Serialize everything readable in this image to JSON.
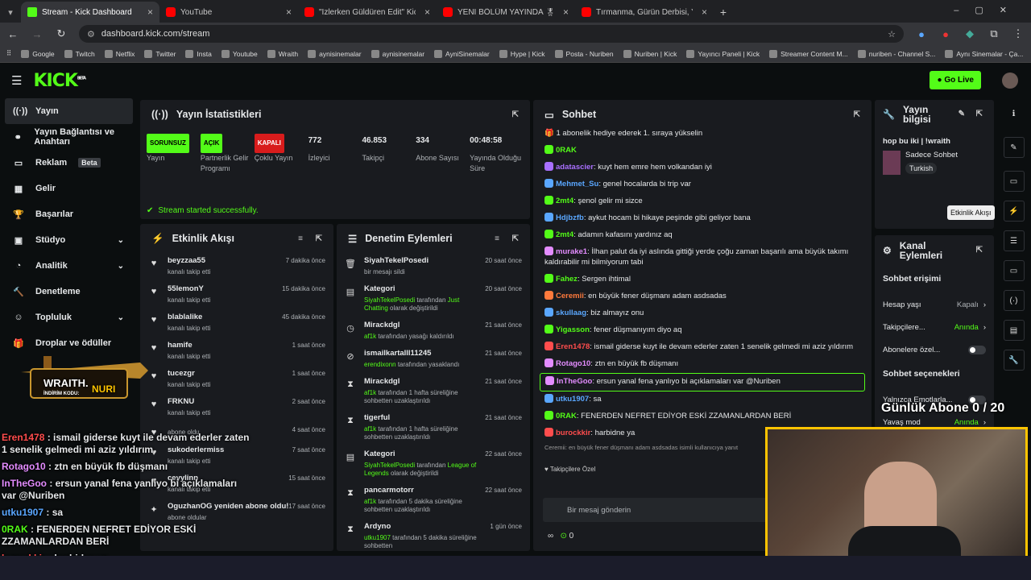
{
  "browser": {
    "tabs": [
      {
        "title": "Stream - Kick Dashboard",
        "icon": "kick-icon",
        "active": true
      },
      {
        "title": "YouTube",
        "icon": "youtube-icon"
      },
      {
        "title": "\"İzlerken Güldüren Edit\" Kick &",
        "icon": "youtube-icon"
      },
      {
        "title": "YENİ BÖLÜM YAYINDA 🎖 @O",
        "icon": "youtube-icon"
      },
      {
        "title": "Tırmanma, Gürün Derbisi, Yükse",
        "icon": "youtube-icon"
      }
    ],
    "url": "dashboard.kick.com/stream",
    "bookmarks": [
      "Google",
      "Twitch",
      "Netflix",
      "Twitter",
      "Insta",
      "Youtube",
      "Wraith",
      "aynisinemalar",
      "aynisinemalar",
      "AyniSinemalar",
      "Hype | Kick",
      "Posta - Nuriben",
      "Nuriben | Kick",
      "Yayıncı Paneli | Kick",
      "Streamer Content M...",
      "nuriben - Channel S...",
      "Aynı Sinemalar - Ça..."
    ]
  },
  "header": {
    "logo": "KICK",
    "beta": "BETA",
    "go_live": "Go Live"
  },
  "sidebar": {
    "items": [
      {
        "label": "Yayın",
        "icon": "broadcast-icon"
      },
      {
        "label": "Yayın Bağlantısı ve Anahtarı",
        "icon": "link-icon"
      },
      {
        "label": "Reklam",
        "badge": "Beta",
        "icon": "ad-icon"
      },
      {
        "label": "Gelir",
        "icon": "revenue-icon"
      },
      {
        "label": "Başarılar",
        "icon": "trophy-icon"
      },
      {
        "label": "Stüdyo",
        "icon": "studio-icon"
      },
      {
        "label": "Analitik",
        "icon": "analytics-icon"
      },
      {
        "label": "Denetleme",
        "icon": "hammer-icon"
      },
      {
        "label": "Topluluk",
        "icon": "community-icon"
      },
      {
        "label": "Droplar ve ödüller",
        "icon": "gift-icon"
      }
    ]
  },
  "stats": {
    "title": "Yayın İstatistikleri",
    "items": [
      {
        "value": "SORUNSUZ",
        "label": "Yayın",
        "pill": "g"
      },
      {
        "value": "AÇIK",
        "label": "Partnerlik Gelir Programı",
        "pill": "g"
      },
      {
        "value": "KAPALI",
        "label": "Çoklu Yayın",
        "pill": "r"
      },
      {
        "value": "772",
        "label": "İzleyici"
      },
      {
        "value": "46.853",
        "label": "Takipçi"
      },
      {
        "value": "334",
        "label": "Abone Sayısı"
      },
      {
        "value": "00:48:58",
        "label": "Yayında Olduğu Süre"
      }
    ],
    "success": "Stream started successfully."
  },
  "activity": {
    "title": "Etkinlik Akışı",
    "rows": [
      {
        "name": "beyzzaa55",
        "sub": "kanalı takip etti",
        "time": "7 dakika önce"
      },
      {
        "name": "55lemonY",
        "sub": "kanalı takip etti",
        "time": "15 dakika önce"
      },
      {
        "name": "blablalike",
        "sub": "kanalı takip etti",
        "time": "45 dakika önce"
      },
      {
        "name": "hamife",
        "sub": "kanalı takip etti",
        "time": "1 saat önce"
      },
      {
        "name": "tucezgr",
        "sub": "kanalı takip etti",
        "time": "1 saat önce"
      },
      {
        "name": "FRKNU",
        "sub": "kanalı takip etti",
        "time": "2 saat önce"
      },
      {
        "name": "",
        "sub": "abone oldu",
        "time": "4 saat önce"
      },
      {
        "name": "sukoderlermiss",
        "sub": "kanalı takip etti",
        "time": "7 saat önce"
      },
      {
        "name": "ceyylinn",
        "sub": "kanalı takip etti",
        "time": "15 saat önce"
      },
      {
        "name": "OguzhanOG yeniden abone oldu!",
        "sub": "abone oldular",
        "time": "17 saat önce"
      }
    ]
  },
  "moderation": {
    "title": "Denetim Eylemleri",
    "rows": [
      {
        "name": "SiyahTekelPosedi",
        "sub": "bir mesajı sildi",
        "time": "20 saat önce",
        "icon": "trash-icon"
      },
      {
        "name": "Kategori",
        "sub1": "SiyahTekelPosedi",
        "sub2": "tarafından",
        "sub3": "Just Chatting",
        "sub4": "olarak değiştirildi",
        "time": "20 saat önce",
        "icon": "category-icon"
      },
      {
        "name": "Mirackdgl",
        "sub1": "af1k",
        "sub2": "tarafından yasağı kaldırıldı",
        "time": "21 saat önce",
        "icon": "clock-icon"
      },
      {
        "name": "ismailkartalll11245",
        "sub1": "erendixonn",
        "sub2": "tarafından yasaklandı",
        "time": "21 saat önce",
        "icon": "ban-icon"
      },
      {
        "name": "Mirackdgl",
        "sub1": "af1k",
        "sub2": "tarafından 1 hafta süreliğine sohbetten uzaklaştırıldı",
        "time": "21 saat önce",
        "icon": "hourglass-icon"
      },
      {
        "name": "tigerful",
        "sub1": "af1k",
        "sub2": "tarafından 1 hafta süreliğine sohbetten uzaklaştırıldı",
        "time": "21 saat önce",
        "icon": "hourglass-icon"
      },
      {
        "name": "Kategori",
        "sub1": "SiyahTekelPosedi",
        "sub2": "tarafından",
        "sub3": "League of Legends",
        "sub4": "olarak değiştirildi",
        "time": "22 saat önce",
        "icon": "category-icon"
      },
      {
        "name": "pancarmotorr",
        "sub1": "af1k",
        "sub2": "tarafından 5 dakika süreliğine sohbetten uzaklaştırıldı",
        "time": "22 saat önce",
        "icon": "hourglass-icon"
      },
      {
        "name": "Ardyno",
        "sub1": "utku1907",
        "sub2": "tarafından 5 dakika süreliğine sohbetten",
        "time": "1 gün önce",
        "icon": "hourglass-icon"
      }
    ]
  },
  "chat": {
    "title": "Sohbet",
    "pinned": "1 abonelik hediye ederek 1. sıraya yükselin",
    "messages": [
      {
        "user": "0RAK",
        "color": "#53fc18",
        "text": ""
      },
      {
        "user": "adatascier",
        "color": "#a970ff",
        "text": ": kuyt hem emre hem volkandan iyi"
      },
      {
        "user": "Mehmet_Su",
        "color": "#5aa7ff",
        "text": ": genel hocalarda bi trip var"
      },
      {
        "user": "2mt4",
        "color": "#53fc18",
        "text": ": şenol gelir mi sizce"
      },
      {
        "user": "Hdjbzfb",
        "color": "#5aa7ff",
        "text": ": aykut hocam bi hikaye peşinde gibi geliyor bana"
      },
      {
        "user": "2mt4",
        "color": "#53fc18",
        "text": ": adamın kafasını yardınız aq"
      },
      {
        "user": "murake1",
        "color": "#e38cff",
        "text": ": İlhan palut da iyi aslında gittiği yerde çoğu zaman başarılı ama büyük takımı kaldırabilir mi bilmiyorum tabi"
      },
      {
        "user": "Fahez",
        "color": "#53fc18",
        "text": ": Sergen ihtimal"
      },
      {
        "user": "Ceremii",
        "color": "#ff7a3c",
        "text": ": en büyük fener düşmanı adam asdsadas"
      },
      {
        "user": "skullaag",
        "color": "#5aa7ff",
        "text": ": biz almayız onu"
      },
      {
        "user": "Yigasson",
        "color": "#53fc18",
        "text": ": fener düşmanıyım diyo aq"
      },
      {
        "user": "Eren1478",
        "color": "#ff4d4d",
        "text": ": ismail giderse kuyt ile devam ederler zaten 1 senelik gelmedi mi aziz yıldırım"
      },
      {
        "user": "Rotago10",
        "color": "#e38cff",
        "text": ": ztn en büyük fb düşmanı"
      },
      {
        "user": "InTheGoo",
        "color": "#e38cff",
        "text": ": ersun yanal fena yanlıyo bi açıklamaları var @Nuriben"
      },
      {
        "user": "utku1907",
        "color": "#5aa7ff",
        "text": ": sa"
      },
      {
        "user": "0RAK",
        "color": "#53fc18",
        "text": ": FENERDEN NEFRET EDİYOR ESKİ ZZAMANLARDAN BERİ"
      },
      {
        "user": "burockkir",
        "color": "#ff4d4d",
        "text": ": harbidne ya"
      }
    ],
    "reply_hint": "Ceremii: en büyük fener düşmanı adam asdsadas isimli kullanıcıya yanıt",
    "followers_only": "Takipçilere Özel",
    "input_placeholder": "Bir mesaj gönderin",
    "points": "0"
  },
  "stream_info": {
    "title": "Yayın bilgisi",
    "stream_title": "hop bu iki | !wraith",
    "category": "Sadece Sohbet",
    "language": "Turkish"
  },
  "channel_actions": {
    "title": "Kanal Eylemleri",
    "section1": "Sohbet erişimi",
    "rows": [
      {
        "label": "Hesap yaşı",
        "value": "Kapalı"
      },
      {
        "label": "Takipçilere...",
        "value": "Anında"
      },
      {
        "label": "Abonelere özel...",
        "value": ""
      }
    ],
    "section2": "Sohbet seçenekleri",
    "rows2": [
      {
        "label": "Yalnızca Emotlarla...",
        "value": ""
      },
      {
        "label": "Yavaş mod",
        "value": "Anında"
      }
    ]
  },
  "tooltip": "Etkinlik Akışı",
  "overlay": {
    "sponsor": "WRAITH.",
    "sponsor_code_label": "İNDİRİM KODU:",
    "sponsor_code": "NURI",
    "goal": "Günlük Abone 0 / 20",
    "chat": [
      {
        "user": "Eren1478",
        "text": " : ismail giderse kuyt ile devam ederler zaten",
        "text2": "1 senelik gelmedi mi aziz yıldırım",
        "color": "#ff4d4d"
      },
      {
        "user": "Rotago10",
        "text": " : ztn en büyük fb düşmanı",
        "color": "#e38cff"
      },
      {
        "user": "InTheGoo",
        "text": " : ersun yanal fena yanlıyo bi açıklamaları",
        "text2": "var @Nuriben",
        "color": "#e38cff"
      },
      {
        "user": "utku1907",
        "text": " : sa",
        "color": "#5aa7ff"
      },
      {
        "user": "0RAK",
        "text": " : FENERDEN NEFRET EDİYOR ESKİ",
        "text2": "ZZAMANLARDAN BERİ",
        "color": "#53fc18"
      },
      {
        "user": "burockkir",
        "text": " : harbidne ya",
        "color": "#ff4d4d"
      }
    ]
  }
}
